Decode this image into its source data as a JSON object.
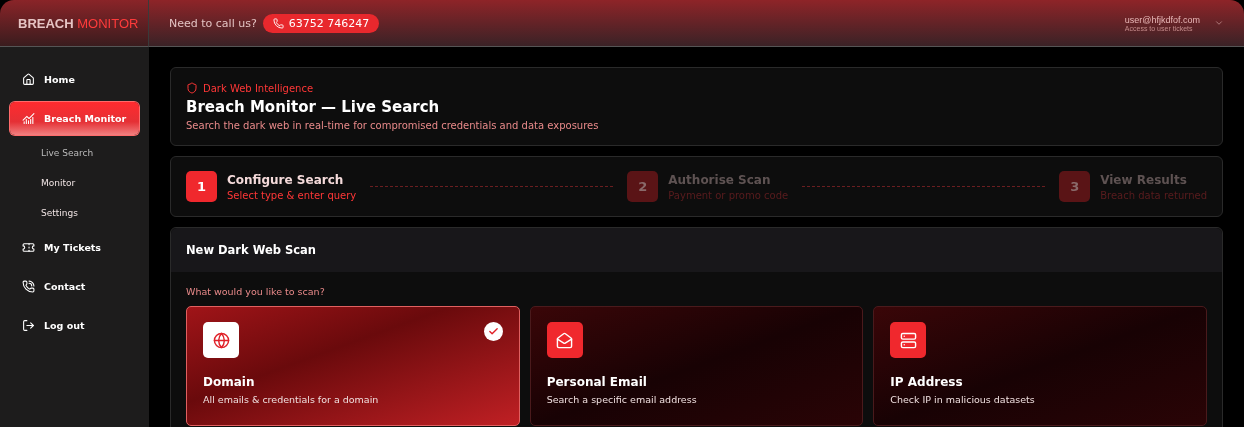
{
  "brand": {
    "first": "BREACH",
    "second": "MONITOR"
  },
  "header": {
    "call_label": "Need to call us?",
    "phone": "63752 746247",
    "user_email": "user@hfjkdfof.com",
    "user_hint": "Access to user tickets"
  },
  "sidebar": {
    "items": [
      {
        "label": "Home",
        "selected": false
      },
      {
        "label": "Breach Monitor",
        "selected": true,
        "children": [
          {
            "label": "Live Search",
            "selected": true
          },
          {
            "label": "Monitor",
            "selected": false
          },
          {
            "label": "Settings",
            "selected": false
          }
        ]
      },
      {
        "label": "My Tickets",
        "selected": false
      },
      {
        "label": "Contact",
        "selected": false
      },
      {
        "label": "Log out",
        "selected": false
      }
    ]
  },
  "hero": {
    "eyebrow": "Dark Web Intelligence",
    "title": "Breach Monitor — Live Search",
    "subtitle": "Search the dark web in real-time for compromised credentials and data exposures"
  },
  "steps": [
    {
      "number": "1",
      "title": "Configure Search",
      "subtitle": "Select type & enter query",
      "active": true
    },
    {
      "number": "2",
      "title": "Authorise Scan",
      "subtitle": "Payment or promo code",
      "active": false
    },
    {
      "number": "3",
      "title": "View Results",
      "subtitle": "Breach data returned",
      "active": false
    }
  ],
  "scan_panel": {
    "title": "New Dark Web Scan",
    "question": "What would you like to scan?",
    "options": [
      {
        "title": "Domain",
        "description": "All emails & credentials for a domain",
        "selected": true
      },
      {
        "title": "Personal Email",
        "description": "Search a specific email address",
        "selected": false
      },
      {
        "title": "IP Address",
        "description": "Check IP in malicious datasets",
        "selected": false
      }
    ]
  }
}
